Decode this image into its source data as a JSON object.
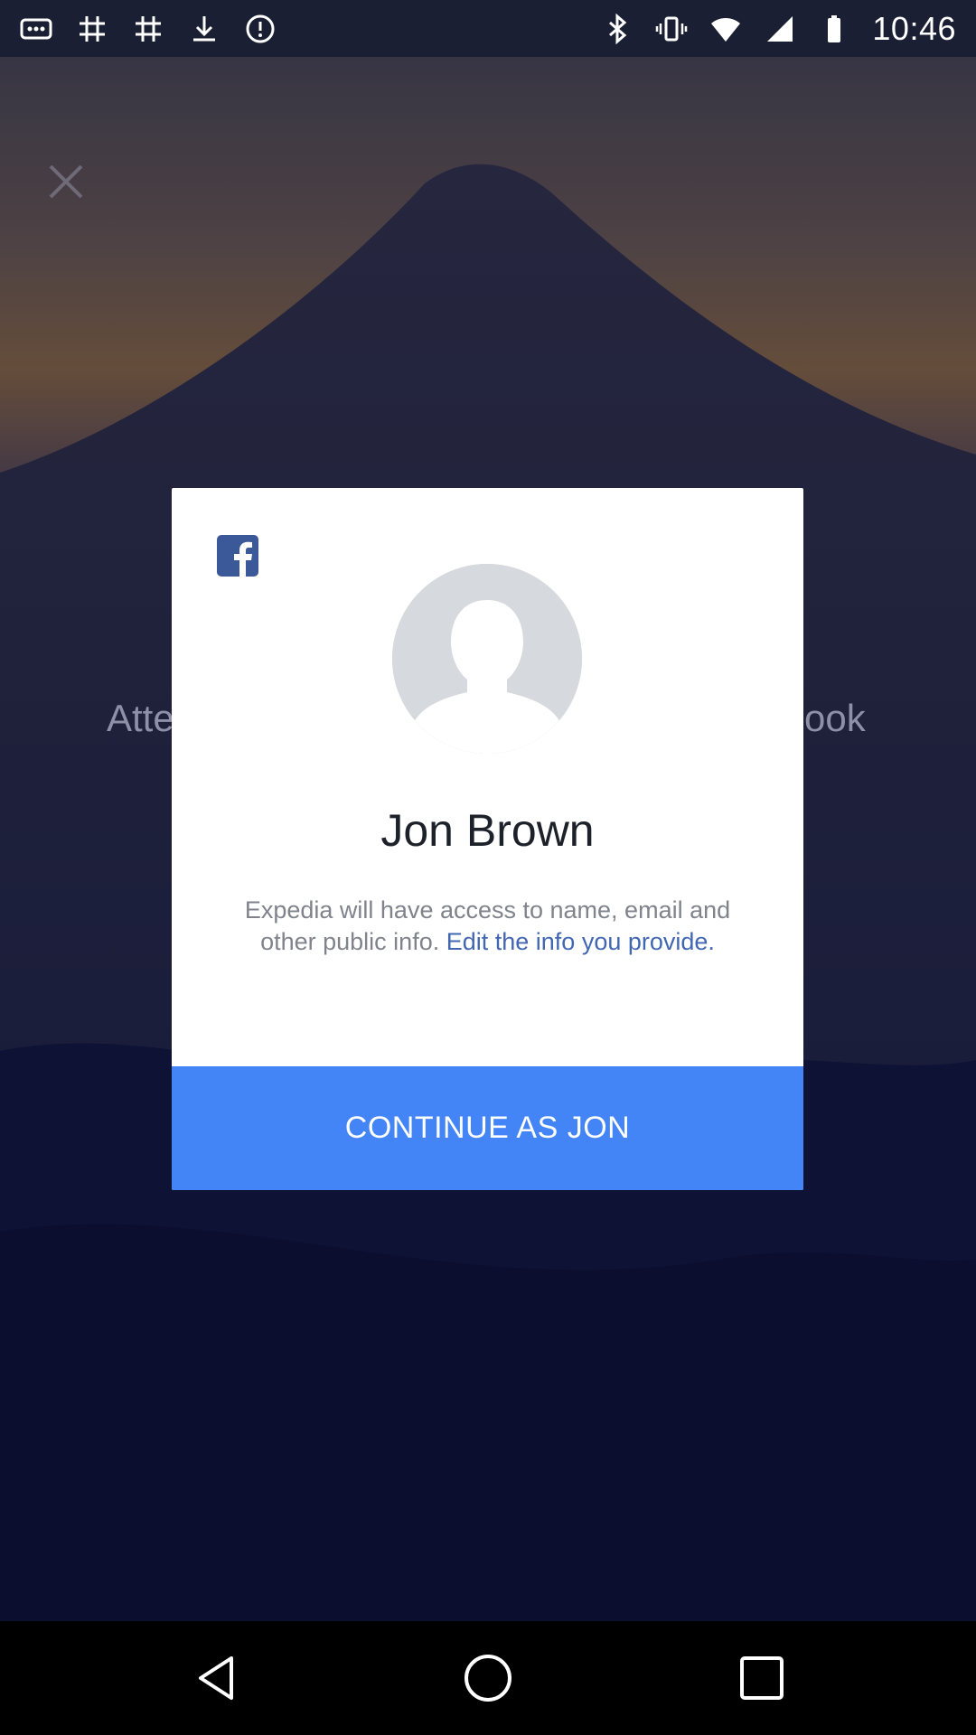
{
  "status_bar": {
    "time": "10:46",
    "left_icons": [
      "more-dots-icon",
      "grid-icon",
      "grid-icon",
      "download-icon",
      "alert-circle-icon"
    ],
    "right_icons": [
      "bluetooth-icon",
      "vibrate-icon",
      "wifi-icon",
      "signal-icon",
      "battery-icon"
    ]
  },
  "background": {
    "text_left": "Atte",
    "text_right": "ook"
  },
  "dialog": {
    "user_name": "Jon Brown",
    "info_text": "Expedia will have access to name, email and other public info. ",
    "edit_link": "Edit the info you provide.",
    "continue_label": "CONTINUE AS JON"
  },
  "colors": {
    "facebook_blue": "#3b5998",
    "link_blue": "#4267b2",
    "button_blue": "#4384f6"
  }
}
